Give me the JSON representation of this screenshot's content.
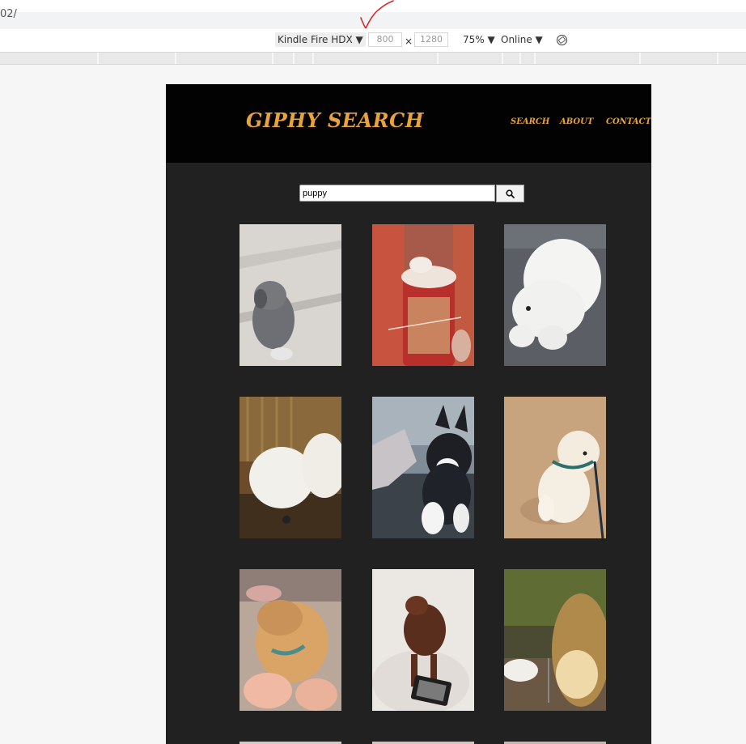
{
  "browser": {
    "url_fragment": "02/",
    "device": "Kindle Fire HDX",
    "width": "800",
    "height": "1280",
    "zoom": "75%",
    "network": "Online",
    "times_sign": "×"
  },
  "app": {
    "title": "GIPHY SEARCH",
    "nav": [
      "SEARCH",
      "ABOUT",
      "CONTACT"
    ]
  },
  "search": {
    "query": "puppy"
  },
  "results": [
    {
      "icon": "puppy-gif"
    },
    {
      "icon": "puppy-gif"
    },
    {
      "icon": "puppy-gif"
    },
    {
      "icon": "puppy-gif"
    },
    {
      "icon": "puppy-gif"
    },
    {
      "icon": "puppy-gif"
    },
    {
      "icon": "puppy-gif"
    },
    {
      "icon": "puppy-gif"
    },
    {
      "icon": "puppy-gif"
    }
  ],
  "colors": {
    "accent": "#e8a33d",
    "header_bg": "#020202",
    "page_bg": "#212121"
  }
}
